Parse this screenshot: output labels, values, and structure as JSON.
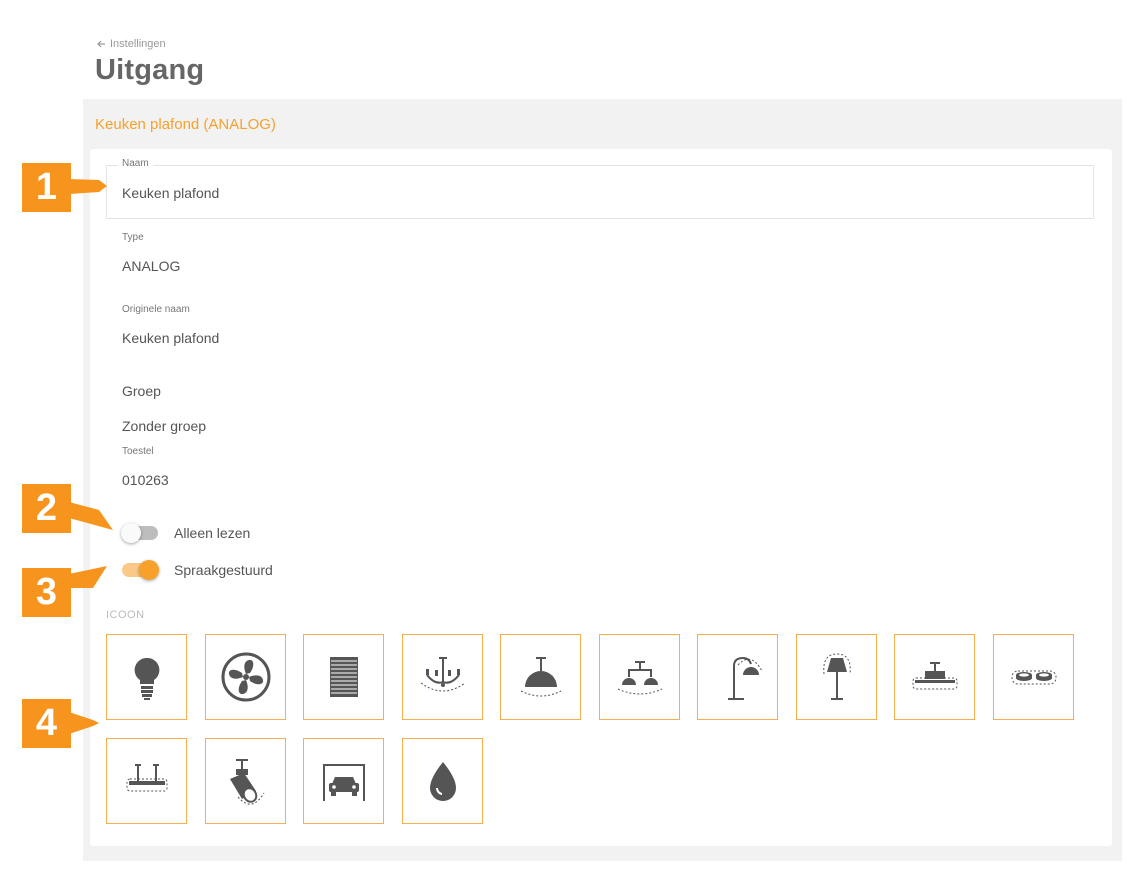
{
  "back": {
    "label": "Instellingen",
    "icon": "arrow-left-icon"
  },
  "page": {
    "title": "Uitgang"
  },
  "panel": {
    "title": "Keuken plafond (ANALOG)"
  },
  "fields": {
    "naam": {
      "label": "Naam",
      "value": "Keuken plafond"
    },
    "type": {
      "label": "Type",
      "value": "ANALOG"
    },
    "originele_naam": {
      "label": "Originele naam",
      "value": "Keuken plafond"
    },
    "groep": {
      "label": "Groep",
      "value": "Zonder groep"
    },
    "toestel": {
      "label": "Toestel",
      "value": "010263"
    }
  },
  "toggles": {
    "alleen_lezen": {
      "label": "Alleen lezen",
      "on": false
    },
    "spraakgestuurd": {
      "label": "Spraakgestuurd",
      "on": true
    }
  },
  "icons": {
    "label": "ICOON",
    "items": [
      "light-bulb-icon",
      "fan-icon",
      "shutter-icon",
      "chandelier-icon",
      "pendant-lamp-icon",
      "double-pendant-lamp-icon",
      "arc-lamp-icon",
      "floor-lamp-icon",
      "ceiling-light-icon",
      "spotlights-icon",
      "suspended-light-icon",
      "spot-icon",
      "garage-icon",
      "water-drop-icon"
    ]
  },
  "callouts": [
    "1",
    "2",
    "3",
    "4"
  ],
  "colors": {
    "accent": "#f7a12b",
    "callout": "#f7941d",
    "tile_border": "#f5b04d",
    "icon": "#555555"
  }
}
